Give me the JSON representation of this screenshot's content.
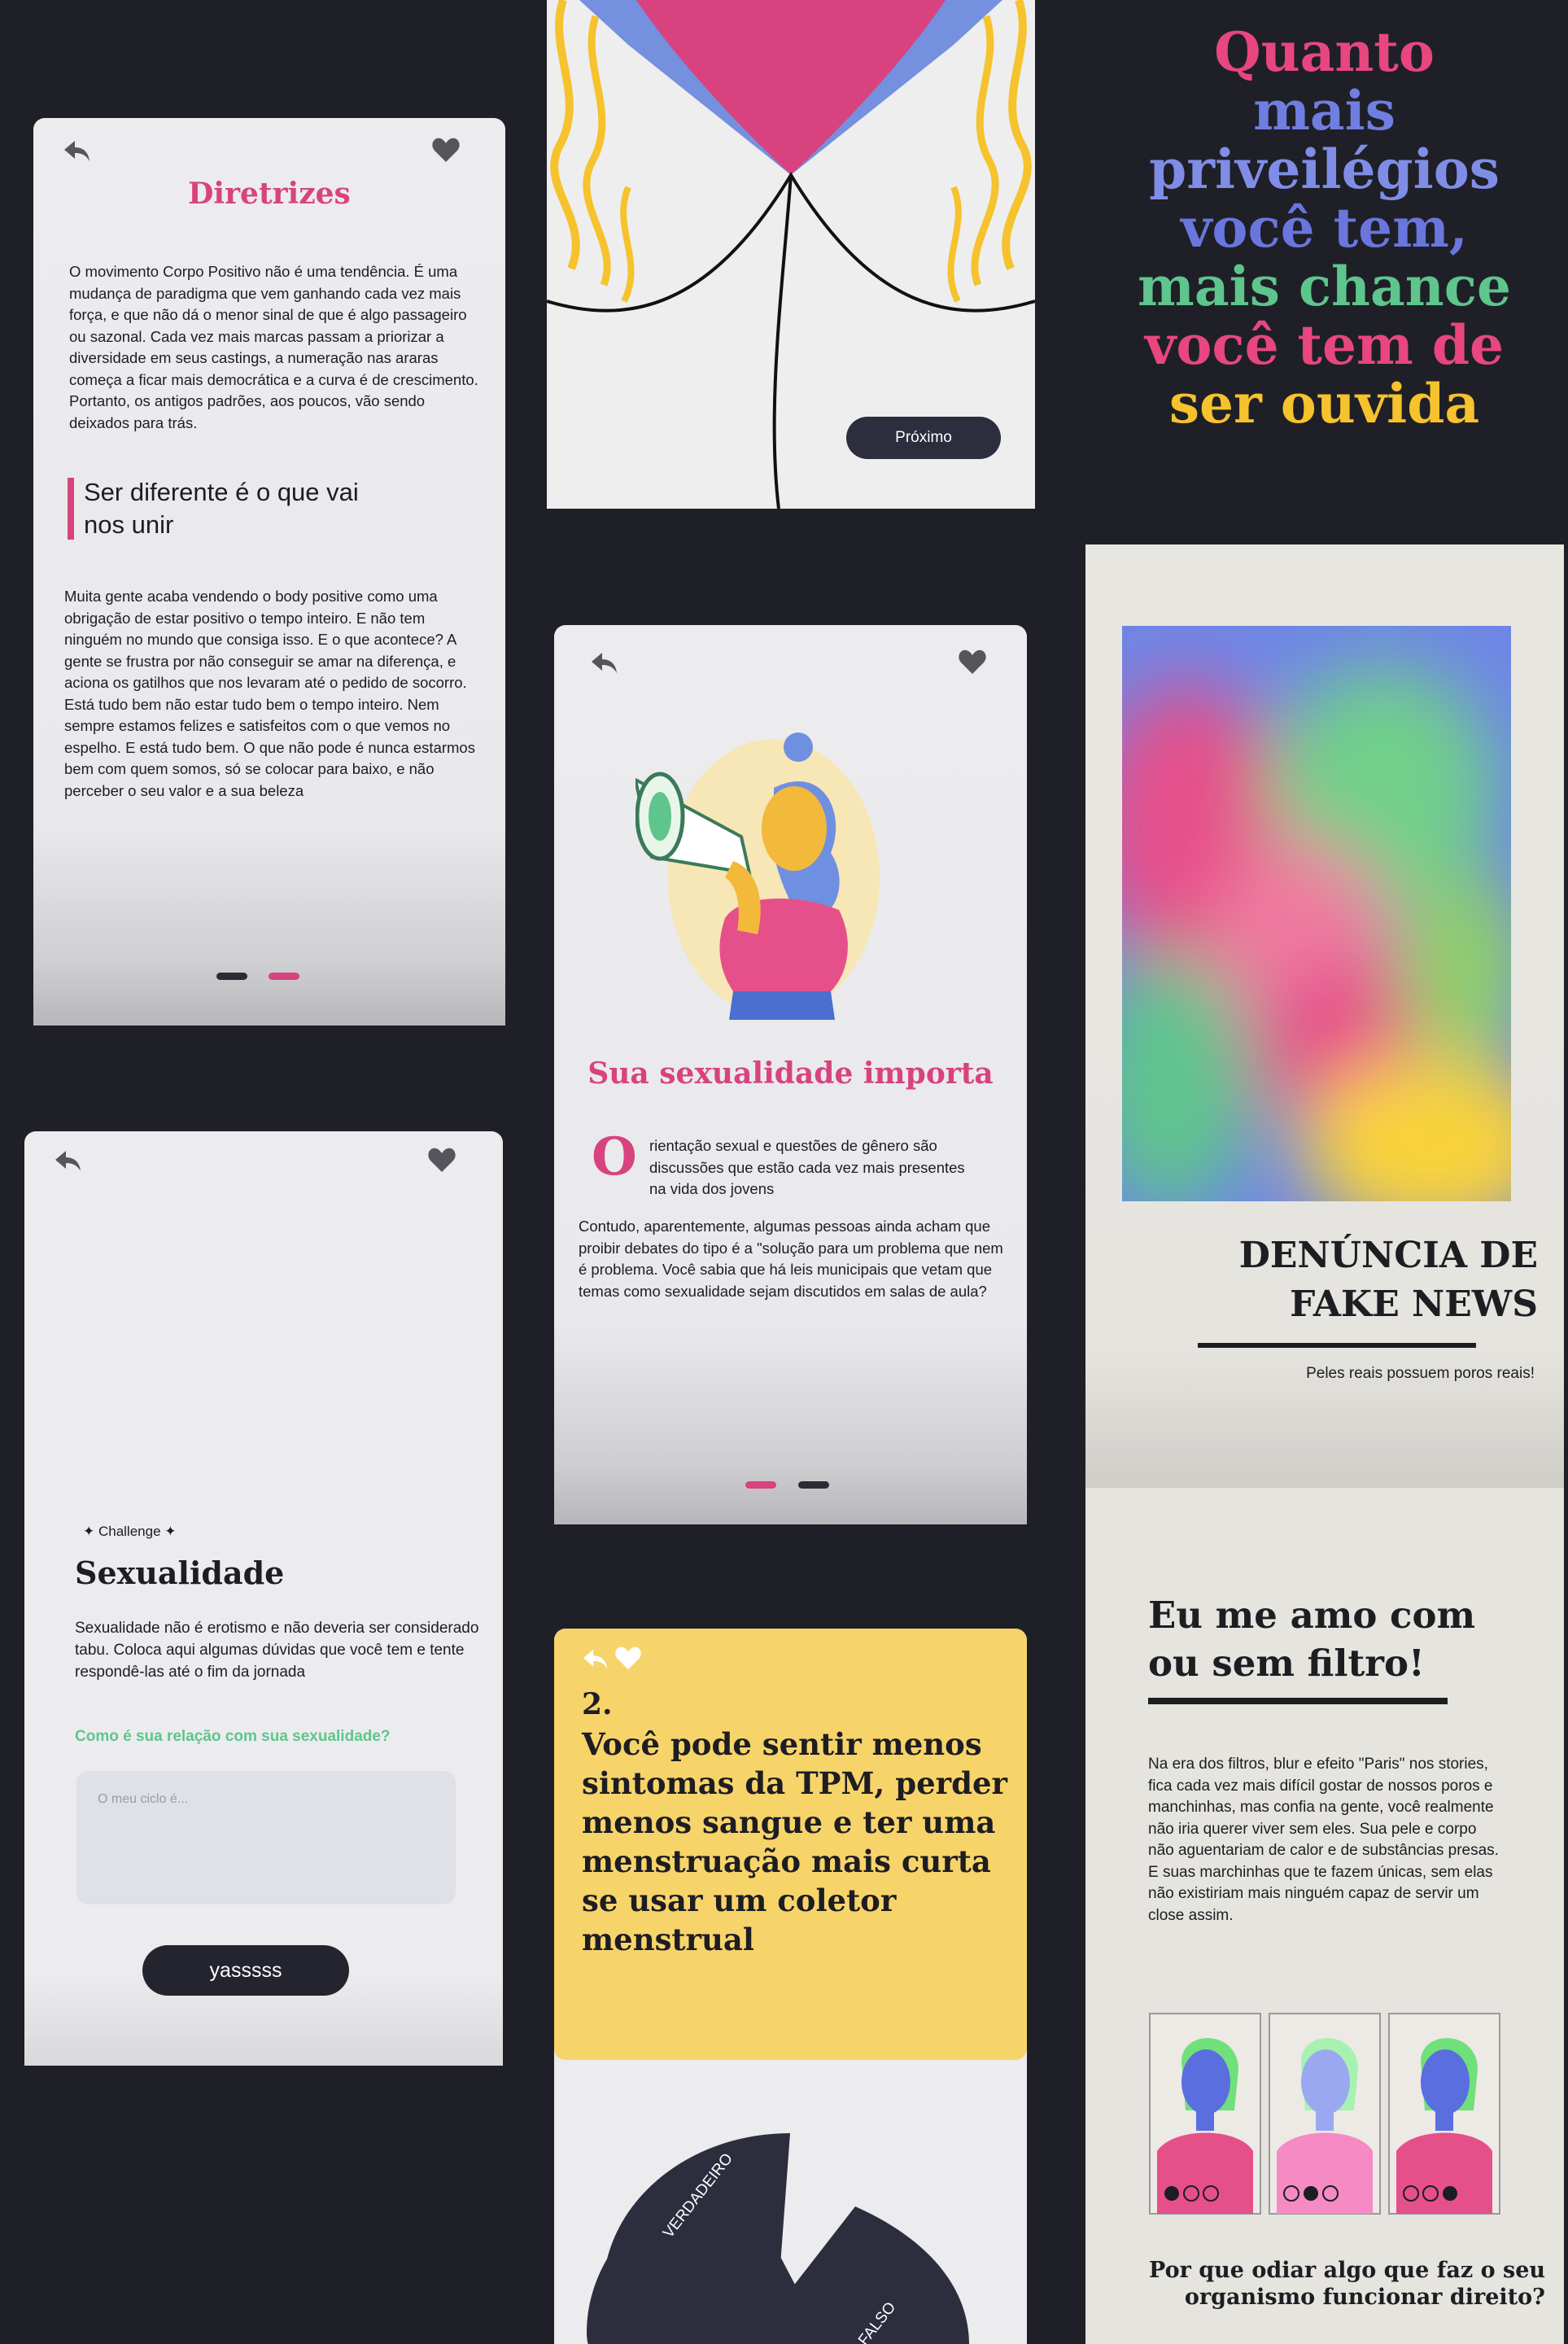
{
  "card1": {
    "title": "Diretrizes",
    "intro": "O movimento Corpo Positivo não é uma tendência. É uma mudança de paradigma que vem ganhando cada vez mais força, e que não dá o menor sinal de que é algo passageiro ou sazonal. Cada vez mais marcas passam a priorizar a diversidade em seus castings, a numeração nas araras começa a ficar mais democrática e a curva é de crescimento. Portanto, os antigos padrões, aos poucos, vão sendo deixados para trás.",
    "quote": "Ser diferente é o que vai nos unir",
    "body": "Muita gente acaba vendendo o body positive como uma obrigação de estar positivo o tempo inteiro. E não tem ninguém no mundo que consiga isso. E o que acontece? A gente se frustra por não conseguir se amar na diferença, e aciona os gatilhos que nos levaram até o pedido de socorro. Está tudo bem não estar tudo bem o tempo inteiro. Nem sempre estamos felizes e satisfeitos com o que vemos no espelho. E está tudo bem. O que não pode é nunca estarmos bem com quem somos, só se colocar para baixo, e não perceber o seu valor e a sua beleza"
  },
  "card2": {
    "next_label": "Próximo"
  },
  "card3": {
    "lines": [
      "Quanto",
      "mais",
      "priveilégios",
      "você tem,",
      "mais chance",
      "você tem de",
      "ser ouvida"
    ]
  },
  "card4": {
    "title": "Sua sexualidade importa",
    "dropcap": "O",
    "lead": "rientação sexual e questões de gênero são discussões que estão cada vez mais presentes na vida dos jovens",
    "body": "Contudo, aparentemente, algumas pessoas ainda acham que proibir debates do tipo é a \"solução para um problema que nem é problema. Você sabia que há leis municipais que vetam que temas como sexualidade sejam discutidos em salas de aula?"
  },
  "card5": {
    "title_line1": "DENÚNCIA DE",
    "title_line2": "FAKE NEWS",
    "subtitle": "Peles reais possuem poros reais!"
  },
  "card6": {
    "eyebrow": "✦ Challenge ✦",
    "title": "Sexualidade",
    "body": "Sexualidade não é erotismo e não deveria ser considerado tabu. Coloca aqui algumas dúvidas que você tem e tente respondê-las até o fim da jornada",
    "question": "Como é sua relação com sua sexualidade?",
    "input_placeholder": "O meu ciclo é...",
    "button_label": "yasssss"
  },
  "card7": {
    "number": "2.",
    "statement": "Você pode sentir menos sintomas da TPM, perder menos sangue e ter uma menstruação mais curta se usar um coletor menstrual",
    "true_label": "VERDADEIRO",
    "false_label": "FALSO"
  },
  "card8": {
    "title_line1": "Eu me amo com",
    "title_line2": "ou sem filtro!",
    "body": "Na era dos filtros, blur e efeito \"Paris\" nos stories, fica cada vez mais difícil gostar de nossos poros e manchinhas, mas confia na gente, você realmente não iria querer viver sem eles. Sua pele e corpo não aguentariam de calor e de substâncias presas. E suas marchinhas que te fazem únicas, sem elas não existiriam mais ninguém capaz de servir um close assim.",
    "question": "Por que odiar algo que faz o seu organismo funcionar direito?"
  },
  "colors": {
    "background": "#1f2027",
    "pink": "#d8437f",
    "yellow": "#f7d46a",
    "navy": "#2c2d3d",
    "green_question": "#5ec58c"
  },
  "icons": [
    "back-arrow-icon",
    "heart-icon",
    "megaphone-woman-illustration",
    "gradient-image",
    "avatar-illustration"
  ]
}
